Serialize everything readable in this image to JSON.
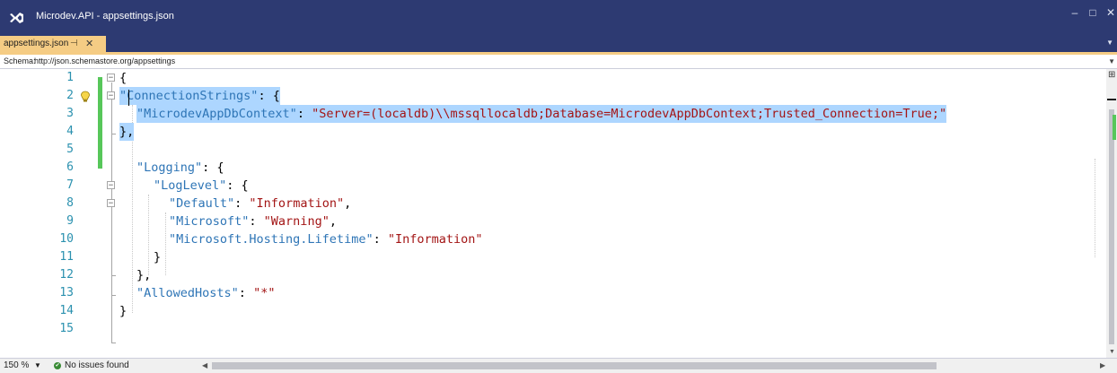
{
  "window": {
    "title": "Microdev.API - appsettings.json",
    "minimize_glyph": "–",
    "maximize_glyph": "□",
    "close_glyph": "✕",
    "title_bar_color": "#2d3a72"
  },
  "tab": {
    "label": "appsettings.json",
    "pin_glyph": "⊣",
    "close_glyph": "✕",
    "active_color": "#f5cc84"
  },
  "schema": {
    "label": "Schema:",
    "value": "http://json.schemastore.org/appsettings"
  },
  "editor": {
    "lines": [
      {
        "number": "1",
        "parts": [
          {
            "t": "{",
            "c": "p"
          }
        ]
      },
      {
        "number": "2",
        "parts": [
          {
            "t": "\"ConnectionStrings\"",
            "c": "k"
          },
          {
            "t": ": {",
            "c": "p"
          }
        ]
      },
      {
        "number": "3",
        "parts": [
          {
            "t": "\"MicrodevAppDbContext\"",
            "c": "k"
          },
          {
            "t": ": ",
            "c": "p"
          },
          {
            "t": "\"Server=(localdb)\\\\mssqllocaldb;Database=MicrodevAppDbContext;Trusted_Connection=True;\"",
            "c": "s"
          }
        ]
      },
      {
        "number": "4",
        "parts": [
          {
            "t": "},",
            "c": "p"
          }
        ]
      },
      {
        "number": "5",
        "parts": []
      },
      {
        "number": "6",
        "parts": [
          {
            "t": "\"Logging\"",
            "c": "k"
          },
          {
            "t": ": {",
            "c": "p"
          }
        ]
      },
      {
        "number": "7",
        "parts": [
          {
            "t": "\"LogLevel\"",
            "c": "k"
          },
          {
            "t": ": {",
            "c": "p"
          }
        ]
      },
      {
        "number": "8",
        "parts": [
          {
            "t": "\"Default\"",
            "c": "k"
          },
          {
            "t": ": ",
            "c": "p"
          },
          {
            "t": "\"Information\"",
            "c": "s"
          },
          {
            "t": ",",
            "c": "p"
          }
        ]
      },
      {
        "number": "9",
        "parts": [
          {
            "t": "\"Microsoft\"",
            "c": "k"
          },
          {
            "t": ": ",
            "c": "p"
          },
          {
            "t": "\"Warning\"",
            "c": "s"
          },
          {
            "t": ",",
            "c": "p"
          }
        ]
      },
      {
        "number": "10",
        "parts": [
          {
            "t": "\"Microsoft.Hosting.Lifetime\"",
            "c": "k"
          },
          {
            "t": ": ",
            "c": "p"
          },
          {
            "t": "\"Information\"",
            "c": "s"
          }
        ]
      },
      {
        "number": "11",
        "parts": [
          {
            "t": "}",
            "c": "p"
          }
        ]
      },
      {
        "number": "12",
        "parts": [
          {
            "t": "},",
            "c": "p"
          }
        ]
      },
      {
        "number": "13",
        "parts": [
          {
            "t": "\"AllowedHosts\"",
            "c": "k"
          },
          {
            "t": ": ",
            "c": "p"
          },
          {
            "t": "\"*\"",
            "c": "s"
          }
        ]
      },
      {
        "number": "14",
        "parts": [
          {
            "t": "}",
            "c": "p"
          }
        ]
      },
      {
        "number": "15",
        "parts": []
      }
    ],
    "key_color": "#2e75b6",
    "string_color": "#a31515",
    "selection_color": "#add6ff",
    "change_bar_color": "#57c75a"
  },
  "status": {
    "zoom": "150 %",
    "issues": "No issues found"
  }
}
